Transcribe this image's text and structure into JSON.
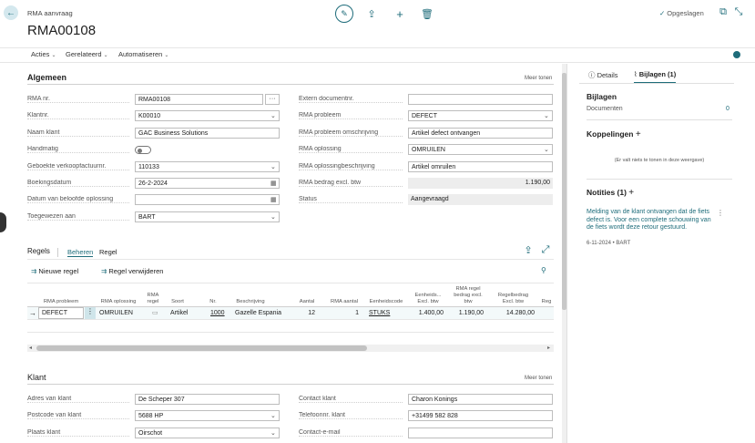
{
  "header": {
    "page_type": "RMA aanvraag",
    "title": "RMA00108",
    "saved": "Opgeslagen"
  },
  "menu": [
    "Acties",
    "Gerelateerd",
    "Automatiseren"
  ],
  "general": {
    "title": "Algemeen",
    "more": "Meer tonen",
    "left": [
      {
        "label": "RMA nr.",
        "value": "RMA00108",
        "kind": "lookup"
      },
      {
        "label": "Klantnr.",
        "value": "K00010",
        "kind": "dropdown"
      },
      {
        "label": "Naam klant",
        "value": "GAC Business Solutions",
        "kind": "text"
      },
      {
        "label": "Handmatig",
        "value": "",
        "kind": "toggle"
      },
      {
        "label": "Geboekte verkoopfactuurnr.",
        "value": "110133",
        "kind": "dropdown"
      },
      {
        "label": "Boekingsdatum",
        "value": "26-2-2024",
        "kind": "date"
      },
      {
        "label": "Datum van beloofde oplossing",
        "value": "",
        "kind": "date"
      },
      {
        "label": "Toegewezen aan",
        "value": "BART",
        "kind": "dropdown"
      }
    ],
    "right": [
      {
        "label": "Extern documentnr.",
        "value": "",
        "kind": "text"
      },
      {
        "label": "RMA probleem",
        "value": "DEFECT",
        "kind": "dropdown"
      },
      {
        "label": "RMA probleem omschrijving",
        "value": "Artikel defect ontvangen",
        "kind": "text"
      },
      {
        "label": "RMA oplossing",
        "value": "OMRUILEN",
        "kind": "dropdown"
      },
      {
        "label": "RMA oplossingbeschrijving",
        "value": "Artikel omruilen",
        "kind": "text"
      },
      {
        "label": "RMA bedrag excl. btw",
        "value": "1.190,00",
        "kind": "readonly-num"
      },
      {
        "label": "Status",
        "value": "Aangevraagd",
        "kind": "readonly"
      }
    ]
  },
  "lines": {
    "title": "Regels",
    "tabs": [
      "Beheren",
      "Regel"
    ],
    "new": "Nieuwe regel",
    "delete": "Regel verwijderen",
    "columns": [
      "RMA probleem",
      "RMA oplossing",
      "RMA regel",
      "Soort",
      "Nr.",
      "Beschrijving",
      "Aantal",
      "RMA aantal",
      "Eenheidscode",
      "Eenheids... Excl. btw",
      "RMA regel bedrag excl. btw",
      "Regelbedrag Excl. btw",
      "Reg"
    ],
    "row": {
      "probleem": "DEFECT",
      "oplossing": "OMRUILEN",
      "soort": "Artikel",
      "nr": "1000",
      "beschrijving": "Gazelle Espania",
      "aantal": "12",
      "rma_aantal": "1",
      "eenheid": "STUKS",
      "eenheidsprijs": "1.400,00",
      "rma_bedrag": "1.190,00",
      "regelbedrag": "14.280,00"
    }
  },
  "customer": {
    "title": "Klant",
    "more": "Meer tonen",
    "left": [
      {
        "label": "Adres van klant",
        "value": "De Scheper 307",
        "kind": "text"
      },
      {
        "label": "Postcode van klant",
        "value": "5688 HP",
        "kind": "dropdown"
      },
      {
        "label": "Plaats klant",
        "value": "Oirschot",
        "kind": "dropdown"
      }
    ],
    "right": [
      {
        "label": "Contact klant",
        "value": "Charon Konings",
        "kind": "text"
      },
      {
        "label": "Telefoonnr. klant",
        "value": "+31499 582 828",
        "kind": "text"
      },
      {
        "label": "Contact-e-mail",
        "value": "",
        "kind": "text"
      }
    ]
  },
  "pane": {
    "tab_details": "Details",
    "tab_attachments": "Bijlagen (1)",
    "attachments_title": "Bijlagen",
    "documents_label": "Documenten",
    "documents_count": "0",
    "links_title": "Koppelingen",
    "links_empty": "(Er valt niets te tonen in deze weergave)",
    "notes_title": "Notities (1)",
    "note_text": "Melding van de klant ontvangen dat de fiets defect is. Voor een complete schouwing van de fiets wordt deze retour gestuurd.",
    "note_meta": "6-11-2024 • BART"
  }
}
